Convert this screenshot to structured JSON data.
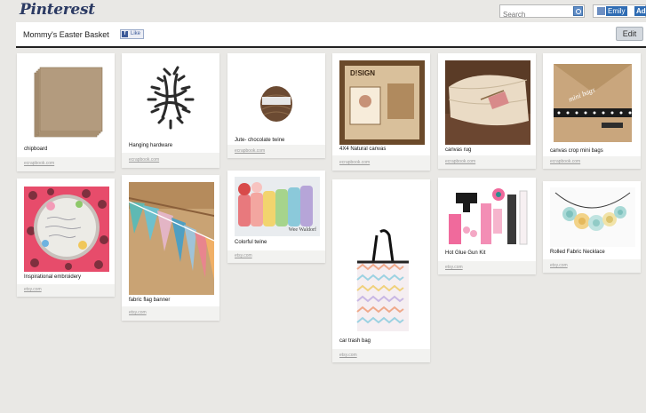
{
  "app": {
    "logo": "Pinterest"
  },
  "topbar": {
    "search_placeholder": "Search",
    "user_name": "Emily",
    "add_label": "Add"
  },
  "board": {
    "title": "Mommy's Easter Basket",
    "like_label": "Like",
    "fb_icon_letter": "f",
    "edit_label": "Edit"
  },
  "pins": [
    {
      "description": "chipboard",
      "source": "ecrapbook.com"
    },
    {
      "description": "Hanging hardware",
      "source": "ecrapbook.com"
    },
    {
      "description": "Jute- chocolate twine",
      "source": "ecrapbook.com"
    },
    {
      "description": "4X4 Natural canvas",
      "source": "ecrapbook.com"
    },
    {
      "description": "canvas rug",
      "source": "ecrapbook.com"
    },
    {
      "description": "canvas crop mini bags",
      "source": "ecrapbook.com"
    },
    {
      "description": "Inspirational embroidery",
      "source": "etsy.com"
    },
    {
      "description": "fabric flag banner",
      "source": "etsy.com"
    },
    {
      "description": "Colorful twine",
      "source": "etsy.com"
    },
    {
      "description": "car trash bag",
      "source": "etsy.com"
    },
    {
      "description": "Hot Glue Gun Kit",
      "source": "etsy.com"
    },
    {
      "description": "Rolled Fabric Necklace",
      "source": "etsy.com"
    }
  ],
  "image_text": {
    "canvas_brand": "D!SIGN",
    "mini_bags_label": "mini bags",
    "twine_label": "Wee Waldorf",
    "embroidery_text": "I can do all things through Christ"
  }
}
